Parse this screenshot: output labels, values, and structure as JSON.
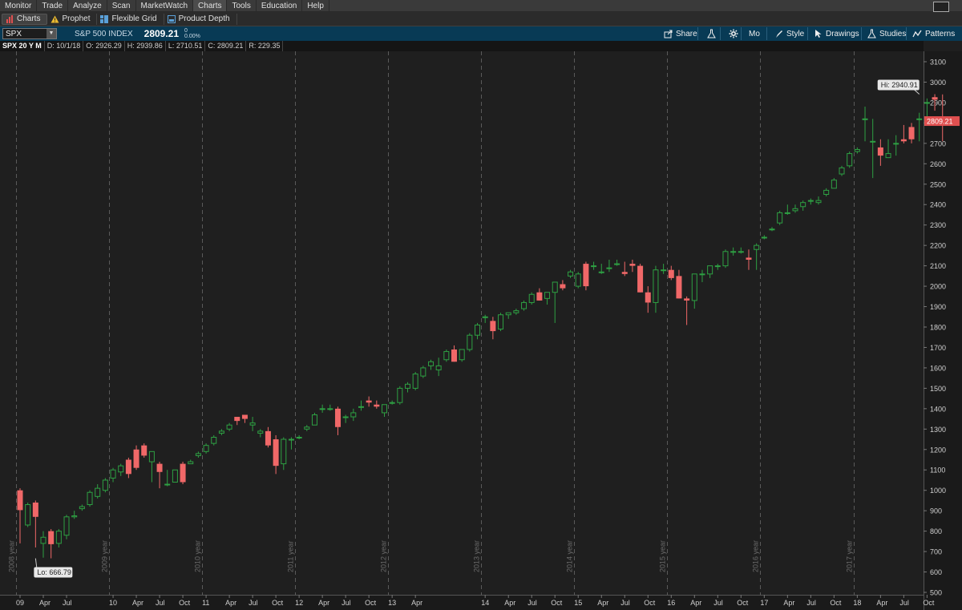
{
  "menu": {
    "items": [
      "Monitor",
      "Trade",
      "Analyze",
      "Scan",
      "MarketWatch",
      "Charts",
      "Tools",
      "Education",
      "Help"
    ],
    "active": "Charts"
  },
  "subtabs": {
    "items": [
      {
        "label": "Charts",
        "icon": "bar-chart-icon",
        "active": true
      },
      {
        "label": "Prophet",
        "icon": "warning-triangle-icon",
        "active": false
      },
      {
        "label": "Flexible Grid",
        "icon": "grid-icon",
        "active": false
      },
      {
        "label": "Product Depth",
        "icon": "depth-icon",
        "active": false
      }
    ]
  },
  "toolbar": {
    "symbol": "SPX",
    "description": "S&P 500 INDEX",
    "price": "2809.21",
    "change": "0",
    "change_pct": "0.00%",
    "share_label": "Share",
    "mo_label": "Mo",
    "style_label": "Style",
    "drawings_label": "Drawings",
    "studies_label": "Studies",
    "patterns_label": "Patterns"
  },
  "infobar": {
    "period": "SPX 20 Y M",
    "date": "D: 10/1/18",
    "open": "O: 2926.29",
    "high": "H: 2939.86",
    "low": "L: 2710.51",
    "close": "C: 2809.21",
    "range": "R: 229.35"
  },
  "colors": {
    "up": "#2ea043",
    "down": "#f06868",
    "background": "#1f1f1f",
    "price_badge": "#e05050"
  },
  "chart_data": {
    "type": "candlestick",
    "symbol": "SPX",
    "aggregation": "monthly",
    "ylim": [
      500,
      3100
    ],
    "y_ticks": [
      500,
      600,
      700,
      800,
      900,
      1000,
      1100,
      1200,
      1300,
      1400,
      1500,
      1600,
      1700,
      1800,
      1900,
      2000,
      2100,
      2200,
      2300,
      2400,
      2500,
      2600,
      2700,
      2800,
      2900,
      3000,
      3100
    ],
    "x_ticks": [
      {
        "month": 0,
        "label": "09"
      },
      {
        "month": 3,
        "label": "Apr"
      },
      {
        "month": 6,
        "label": "Jul"
      },
      {
        "month": 12,
        "label": "10"
      },
      {
        "month": 15,
        "label": "Apr"
      },
      {
        "month": 18,
        "label": "Jul"
      },
      {
        "month": 21,
        "label": "Oct"
      },
      {
        "month": 24,
        "label": "11"
      },
      {
        "month": 27,
        "label": "Apr"
      },
      {
        "month": 30,
        "label": "Jul"
      },
      {
        "month": 33,
        "label": "Oct"
      },
      {
        "month": 36,
        "label": "12"
      },
      {
        "month": 39,
        "label": "Apr"
      },
      {
        "month": 42,
        "label": "Jul"
      },
      {
        "month": 45,
        "label": "Oct"
      },
      {
        "month": 48,
        "label": "13"
      },
      {
        "month": 51,
        "label": "Apr"
      },
      {
        "month": 60,
        "label": "14"
      },
      {
        "month": 63,
        "label": "Apr"
      },
      {
        "month": 66,
        "label": "Jul"
      },
      {
        "month": 69,
        "label": "Oct"
      },
      {
        "month": 72,
        "label": "15"
      },
      {
        "month": 75,
        "label": "Apr"
      },
      {
        "month": 78,
        "label": "Jul"
      },
      {
        "month": 81,
        "label": "Oct"
      },
      {
        "month": 84,
        "label": "16"
      },
      {
        "month": 87,
        "label": "Apr"
      },
      {
        "month": 90,
        "label": "Jul"
      },
      {
        "month": 93,
        "label": "Oct"
      },
      {
        "month": 96,
        "label": "17"
      },
      {
        "month": 99,
        "label": "Apr"
      },
      {
        "month": 102,
        "label": "Jul"
      },
      {
        "month": 105,
        "label": "Oct"
      },
      {
        "month": 108,
        "label": "18"
      },
      {
        "month": 111,
        "label": "Apr"
      },
      {
        "month": 114,
        "label": "Jul"
      },
      {
        "month": 117,
        "label": "Oct"
      }
    ],
    "year_markers": [
      {
        "month": -1,
        "label": "2008 year"
      },
      {
        "month": 11,
        "label": "2009 year"
      },
      {
        "month": 23,
        "label": "2010 year"
      },
      {
        "month": 35,
        "label": "2011 year"
      },
      {
        "month": 47,
        "label": "2012 year"
      },
      {
        "month": 59,
        "label": "2013 year"
      },
      {
        "month": 71,
        "label": "2014 year"
      },
      {
        "month": 83,
        "label": "2015 year"
      },
      {
        "month": 95,
        "label": "2016 year"
      },
      {
        "month": 107,
        "label": "2017 year"
      }
    ],
    "annotations": {
      "hi": {
        "label": "Hi: 2940.91",
        "value": 2940.91,
        "month": 116
      },
      "lo": {
        "label": "Lo: 666.79",
        "value": 666.79,
        "month": 2
      },
      "last": {
        "label": "2809.21",
        "value": 2809.21
      }
    },
    "closes": [
      903,
      930,
      870,
      770,
      736,
      800,
      870,
      875,
      920,
      990,
      1010,
      1050,
      1100,
      1120,
      1080,
      1110,
      1170,
      1190,
      1090,
      1030,
      1100,
      1040,
      1140,
      1180,
      1220,
      1260,
      1290,
      1320,
      1340,
      1350,
      1330,
      1290,
      1220,
      1120,
      1250,
      1250,
      1260,
      1310,
      1370,
      1400,
      1400,
      1310,
      1360,
      1380,
      1410,
      1430,
      1410,
      1420,
      1430,
      1500,
      1520,
      1570,
      1600,
      1630,
      1610,
      1680,
      1630,
      1690,
      1760,
      1810,
      1850,
      1780,
      1860,
      1870,
      1880,
      1920,
      1960,
      1930,
      1970,
      2020,
      1990,
      2070,
      2060,
      2000,
      2100,
      2070,
      2090,
      2110,
      2060,
      2100,
      1970,
      1920,
      2080,
      2080,
      2040,
      1940,
      1930,
      2060,
      2060,
      2100,
      2100,
      2170,
      2170,
      2170,
      2130,
      2200,
      2240,
      2280,
      2360,
      2360,
      2380,
      2410,
      2420,
      2420,
      2470,
      2520,
      2580,
      2650,
      2670,
      2820,
      2710,
      2640,
      2650,
      2700,
      2710,
      2720,
      2820,
      2900,
      2914,
      2809.21
    ],
    "opens": [
      1000,
      830,
      940,
      740,
      800,
      740,
      780,
      870,
      910,
      930,
      970,
      1000,
      1060,
      1090,
      1150,
      1200,
      1220,
      1140,
      1130,
      1030,
      1040,
      1130,
      1130,
      1170,
      1190,
      1230,
      1280,
      1300,
      1360,
      1370,
      1320,
      1280,
      1290,
      1250,
      1130,
      1250,
      1260,
      1300,
      1320,
      1400,
      1400,
      1400,
      1360,
      1360,
      1410,
      1440,
      1420,
      1380,
      1430,
      1430,
      1500,
      1500,
      1560,
      1610,
      1590,
      1640,
      1690,
      1640,
      1690,
      1760,
      1850,
      1830,
      1790,
      1860,
      1870,
      1890,
      1920,
      1970,
      1940,
      1970,
      2010,
      2050,
      2000,
      2110,
      2100,
      2070,
      2090,
      2110,
      2070,
      2110,
      2100,
      1970,
      1920,
      2080,
      2080,
      2050,
      1940,
      1930,
      2060,
      2060,
      2100,
      2100,
      2170,
      2170,
      2140,
      2180,
      2240,
      2280,
      2310,
      2360,
      2370,
      2390,
      2420,
      2410,
      2450,
      2480,
      2550,
      2590,
      2660,
      2820,
      2710,
      2680,
      2630,
      2700,
      2720,
      2780,
      2820,
      2900,
      2926.29
    ],
    "highs": [
      1010,
      940,
      950,
      800,
      810,
      810,
      880,
      900,
      930,
      1000,
      1030,
      1060,
      1110,
      1130,
      1160,
      1220,
      1230,
      1150,
      1140,
      1100,
      1100,
      1140,
      1150,
      1190,
      1230,
      1270,
      1300,
      1330,
      1350,
      1370,
      1360,
      1300,
      1310,
      1270,
      1260,
      1260,
      1270,
      1320,
      1380,
      1420,
      1420,
      1410,
      1370,
      1400,
      1440,
      1460,
      1440,
      1420,
      1440,
      1510,
      1530,
      1580,
      1610,
      1640,
      1650,
      1690,
      1710,
      1690,
      1770,
      1820,
      1860,
      1850,
      1870,
      1870,
      1890,
      1930,
      1970,
      1990,
      1960,
      1980,
      2030,
      2080,
      2070,
      2120,
      2120,
      2110,
      2130,
      2130,
      2120,
      2130,
      2110,
      2000,
      2100,
      2110,
      2100,
      2080,
      1950,
      1960,
      2080,
      2100,
      2110,
      2180,
      2190,
      2190,
      2180,
      2210,
      2250,
      2290,
      2370,
      2400,
      2400,
      2420,
      2430,
      2440,
      2480,
      2530,
      2590,
      2660,
      2680,
      2880,
      2820,
      2720,
      2720,
      2740,
      2790,
      2800,
      2850,
      2920,
      2940.91,
      2939.86
    ],
    "lows": [
      740,
      820,
      720,
      670,
      666.79,
      720,
      760,
      860,
      900,
      920,
      960,
      990,
      1040,
      1070,
      1060,
      1100,
      1160,
      1040,
      1010,
      1020,
      1040,
      1030,
      1130,
      1160,
      1180,
      1220,
      1270,
      1290,
      1320,
      1330,
      1290,
      1260,
      1210,
      1080,
      1100,
      1200,
      1250,
      1290,
      1320,
      1380,
      1390,
      1270,
      1330,
      1340,
      1390,
      1410,
      1400,
      1360,
      1420,
      1420,
      1480,
      1490,
      1550,
      1590,
      1560,
      1630,
      1630,
      1630,
      1680,
      1740,
      1820,
      1740,
      1780,
      1840,
      1860,
      1880,
      1910,
      1930,
      1910,
      1820,
      1980,
      2040,
      1990,
      1980,
      2080,
      2060,
      2070,
      2100,
      2050,
      2070,
      1970,
      1870,
      1870,
      2060,
      2030,
      1940,
      1810,
      1890,
      2020,
      2040,
      2080,
      2090,
      2150,
      2160,
      2080,
      2080,
      2230,
      2270,
      2300,
      2350,
      2360,
      2370,
      2400,
      2400,
      2440,
      2480,
      2540,
      2580,
      2650,
      2710,
      2530,
      2590,
      2630,
      2640,
      2700,
      2700,
      2710,
      2800,
      2860,
      2710.51
    ]
  }
}
